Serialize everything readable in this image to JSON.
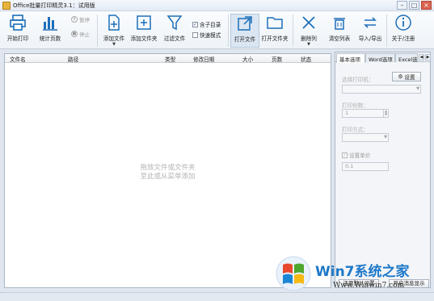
{
  "window": {
    "title": "Office批量打印精灵3.1：试用版"
  },
  "toolbar": {
    "start_print": "开始打印",
    "stats_pages": "统计页数",
    "pause": "暂停",
    "stop": "停止",
    "add_file": "添加文件",
    "add_folder": "添加文件夹",
    "filter_file": "过滤文件",
    "include_subdir": "含子目录",
    "fast_mode": "快速模式",
    "open_file": "打开文件",
    "open_folder": "打开文件夹",
    "delete_col": "删除列",
    "clear_list": "清空列表",
    "import_export": "导入/导出",
    "about": "关于/注册"
  },
  "list": {
    "columns": [
      "文件名",
      "路径",
      "类型",
      "修改日期",
      "大小",
      "页数",
      "状态"
    ],
    "empty_line1": "拖放文件或文件夹",
    "empty_line2": "至此或从菜单添加"
  },
  "panel": {
    "tabs": [
      "基本选项",
      "Word选项",
      "Excel选"
    ],
    "select_printer": "选择打印机：",
    "settings_btn": "设置",
    "copies_label": "打印份数：",
    "copies_value": "1",
    "print_mode": "打印方式：",
    "set_unit_price": "设置单价",
    "unit_price_value": "0.1",
    "restore_default": "还原默认设置",
    "open_msg": "开启消息显示"
  },
  "watermark": {
    "brand": "Win7系统之家",
    "url": "Www.Winwin7.com"
  },
  "colors": {
    "accent": "#1d6fb8",
    "bg": "#dfe6ef"
  }
}
